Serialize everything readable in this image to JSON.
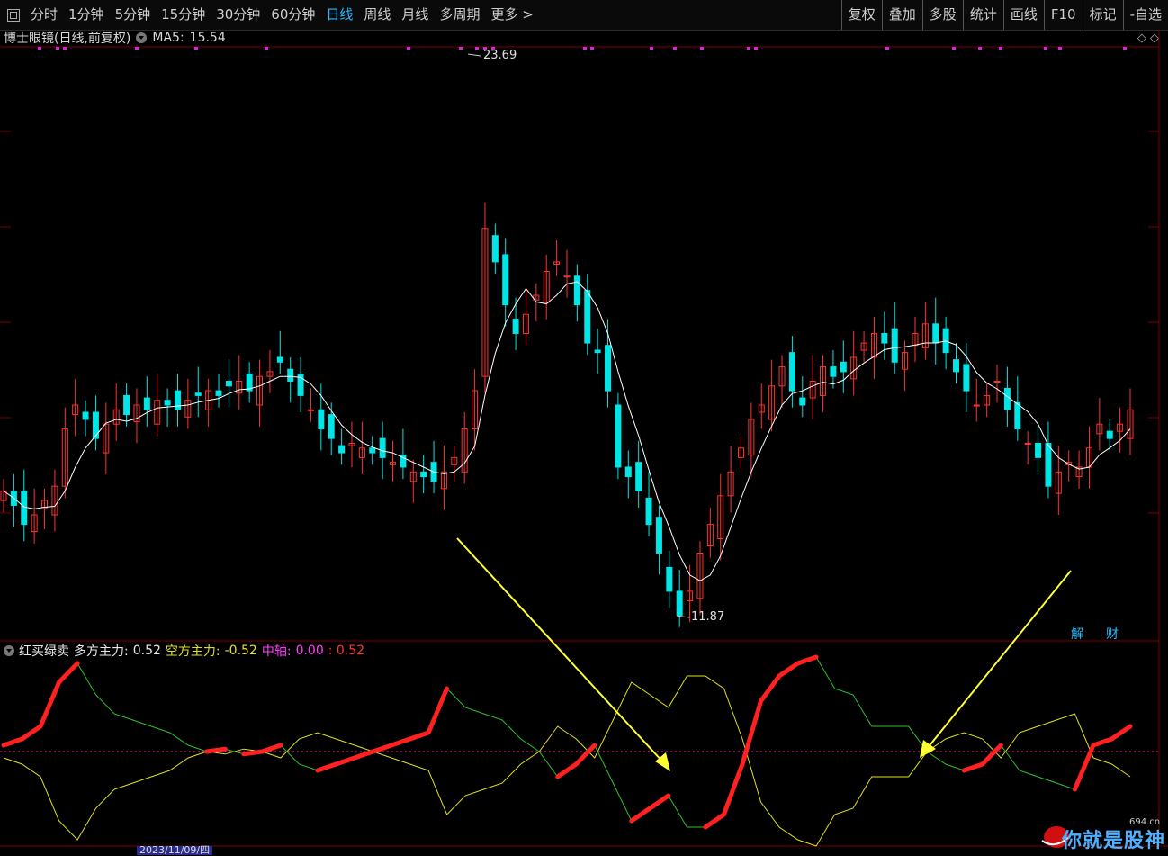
{
  "toolbar": {
    "left": [
      "分时",
      "1分钟",
      "5分钟",
      "15分钟",
      "30分钟",
      "60分钟",
      "日线",
      "周线",
      "月线",
      "多周期",
      "更多 >"
    ],
    "active": "日线",
    "right": [
      "复权",
      "叠加",
      "多股",
      "统计",
      "画线",
      "F10",
      "标记",
      "-自选"
    ]
  },
  "price_header": {
    "title": "博士眼镜(日线,前复权)",
    "ma_label": "MA5:",
    "ma_value": "15.54"
  },
  "price_labels": {
    "high": "23.69",
    "low": "11.87"
  },
  "indicator_header": {
    "name": "红买绿卖",
    "bull_label": "多方主力:",
    "bull_value": "0.52",
    "bear_label": "空方主力:",
    "bear_value": "-0.52",
    "mid_label": "中轴:",
    "mid_value": "0.00",
    "extra_value": ": 0.52"
  },
  "side_buttons": {
    "jie": "解",
    "cai": "财"
  },
  "top_icons": "◇ ◇",
  "date_axis": {
    "selected": "2023/11/09/四"
  },
  "logo": {
    "text": "你就是股神",
    "sub": "694.cn"
  },
  "colors": {
    "up": "#ff3232",
    "down": "#00e5e5",
    "ma": "#ffffff",
    "bull": "#ff2020",
    "bear": "#e0e020",
    "neutral_line": "#30c030",
    "active": "#25b8ff",
    "arrow": "#ffff33"
  }
}
